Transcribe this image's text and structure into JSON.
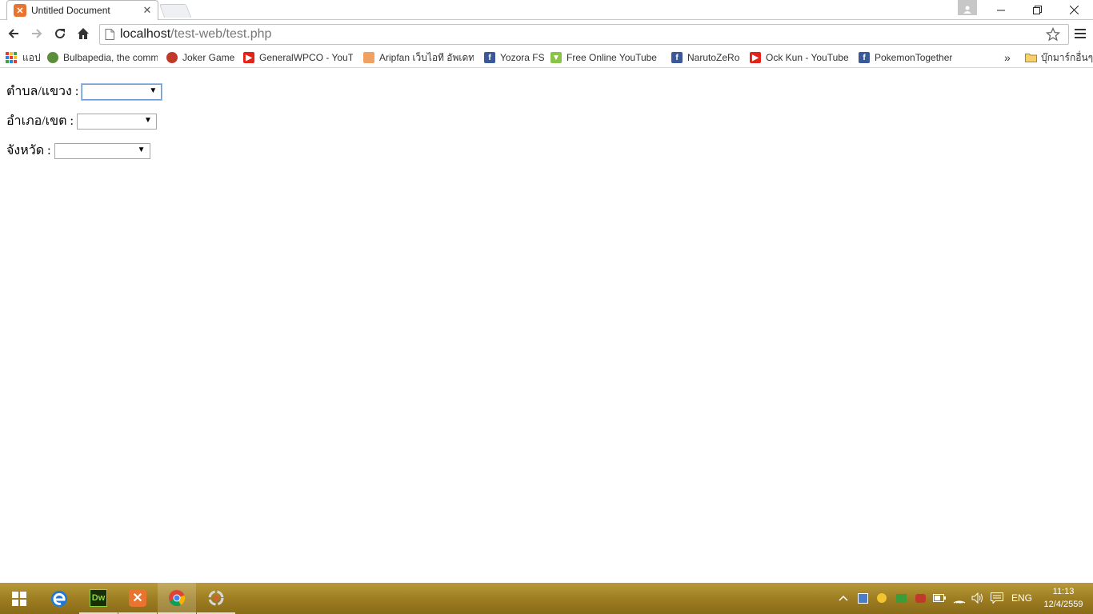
{
  "browser": {
    "tab": {
      "title": "Untitled Document",
      "favicon": "xampp-icon"
    },
    "url": {
      "host": "localhost",
      "path": "/test-web/test.php"
    },
    "bookmarks": [
      {
        "label": "แอป",
        "icon": "apps-icon"
      },
      {
        "label": "Bulbapedia, the comm",
        "icon": "bulbapedia-icon"
      },
      {
        "label": "Joker Game",
        "icon": "joker-icon"
      },
      {
        "label": "GeneralWPCO - YouTu",
        "icon": "youtube-icon"
      },
      {
        "label": "Aripfan เว็บไอที อัพเดทข",
        "icon": "aripfan-icon"
      },
      {
        "label": "Yozora FS",
        "icon": "facebook-icon"
      },
      {
        "label": "Free Online YouTube",
        "icon": "download-icon"
      },
      {
        "label": "NarutoZeRo",
        "icon": "facebook-icon"
      },
      {
        "label": "Ock Kun - YouTube",
        "icon": "youtube-icon"
      },
      {
        "label": "PokemonTogether",
        "icon": "facebook-icon"
      }
    ],
    "overflow_label": "»",
    "other_bookmarks": "บุ๊กมาร์กอื่นๆ"
  },
  "form": {
    "subdistrict": {
      "label": "ตำบล/แขวง :",
      "value": ""
    },
    "district": {
      "label": "อำเภอ/เขต :",
      "value": ""
    },
    "province": {
      "label": "จังหวัด :",
      "value": ""
    }
  },
  "taskbar": {
    "apps": [
      "windows-start-icon",
      "edge-icon",
      "dreamweaver-icon",
      "xampp-icon",
      "chrome-icon",
      "recycle-icon"
    ],
    "dreamweaver_label": "Dw",
    "language": "ENG",
    "time": "11:13",
    "date": "12/4/2559"
  },
  "colors": {
    "xampp": "#e8742f",
    "youtube": "#e62117",
    "facebook": "#3b5998",
    "taskbar": "#9d7e22",
    "focus": "#6b9bd2"
  }
}
